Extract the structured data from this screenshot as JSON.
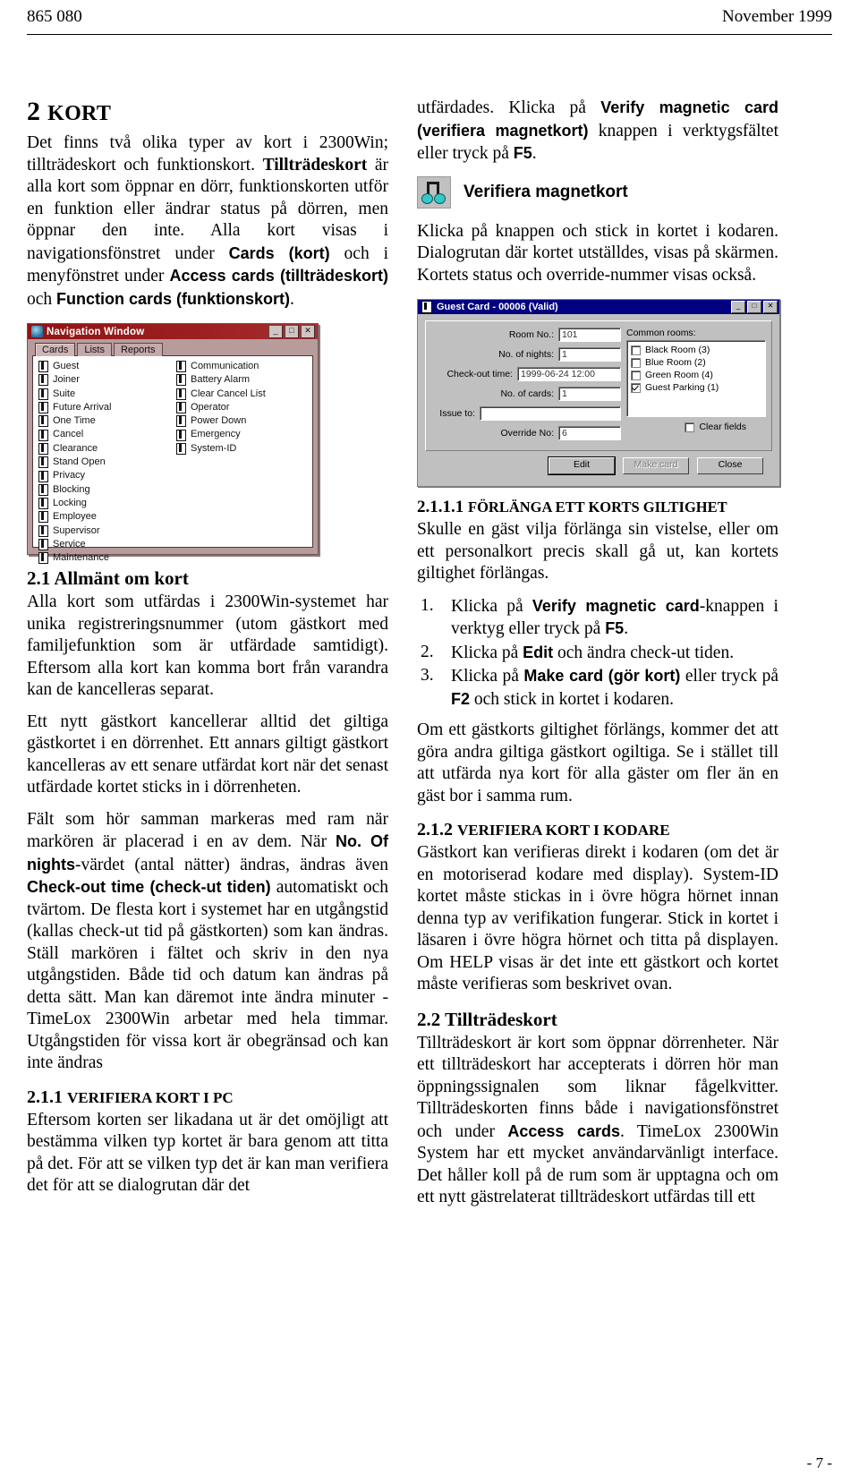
{
  "header": {
    "left": "865 080",
    "right": "November 1999"
  },
  "footer": {
    "page": "- 7 -"
  },
  "left_column": {
    "chapter_num": "2 ",
    "chapter_title": "KORT",
    "intro_p1_a": "Det finns två olika typer av kort i 2300Win; tillträdeskort och funktionskort. ",
    "intro_p1_b": "Tillträdeskort",
    "intro_p1_c": " är alla kort som öppnar en dörr, funktionskorten utför en funktion eller ändrar status på dörren, men öppnar den inte. Alla kort visas i navigationsfönstret under ",
    "intro_p1_d": "Cards (kort)",
    "intro_p1_e": " och i menyfönstret under ",
    "intro_p1_f": "Access cards (tillträdeskort)",
    "intro_p1_g": " och ",
    "intro_p1_h": "Function cards (funktionskort)",
    "intro_p1_i": ".",
    "sec21_title": "2.1 Allmänt om kort",
    "sec21_p1": "Alla kort som utfärdas i 2300Win-systemet har unika registreringsnummer (utom gästkort med familjefunktion som är utfärdade samtidigt). Eftersom alla kort kan komma bort från varandra kan de kancelleras separat.",
    "sec21_p2": "Ett nytt gästkort kancellerar alltid det giltiga gästkortet i en dörrenhet. Ett annars giltigt gästkort kancelleras av ett senare utfärdat kort när det senast utfärdade kortet sticks in i dörrenheten.",
    "sec21_p3_a": "Fält som hör samman markeras med ram när markören är placerad i en av dem. När ",
    "sec21_p3_b": "No. Of nights",
    "sec21_p3_c": "-värdet (antal nätter) ändras, ändras även ",
    "sec21_p3_d": "Check-out time (check-ut tiden)",
    "sec21_p3_e": " automatiskt och tvärtom. De flesta kort i systemet har en utgångstid (kallas check-ut tid på gästkorten) som kan ändras. Ställ markören i fältet och skriv in den nya utgångstiden. Både tid och datum kan ändras på detta sätt. Man kan däremot inte ändra minuter - TimeLox 2300Win arbetar med hela timmar. Utgångstiden för vissa kort är obegränsad och kan inte ändras",
    "sec211_num": "2.1.1 ",
    "sec211_title": "VERIFIERA KORT I PC",
    "sec211_p1": "Eftersom korten ser likadana ut är det omöjligt att bestämma vilken typ kortet är bara genom att titta på det. För att se vilken typ det är kan man verifiera det för att se dialogrutan där det"
  },
  "right_column": {
    "cont_p1_a": "utfärdades. Klicka på ",
    "cont_p1_b": "Verify magnetic card (verifiera magnetkort)",
    "cont_p1_c": " knappen i verktygsfältet eller tryck på ",
    "cont_p1_d": "F5",
    "cont_p1_e": ".",
    "toolbar_icon_label": "Verifiera magnetkort",
    "toolbar_icon_name": "verify-magnetic-card-icon",
    "cont_p2": "Klicka på knappen och stick in kortet i kodaren. Dialogrutan där kortet utställdes, visas på skärmen. Kortets status och override-nummer visas också.",
    "sec2111_num": "2.1.1.1 ",
    "sec2111_title": "FÖRLÄNGA ETT KORTS GILTIGHET",
    "sec2111_p1": "Skulle en gäst vilja förlänga sin vistelse, eller om ett personalkort precis skall gå ut, kan kortets giltighet förlängas.",
    "steps": [
      {
        "a": "Klicka på ",
        "b": "Verify magnetic card",
        "c": "-knappen i verktyg eller tryck på ",
        "d": "F5",
        "e": "."
      },
      {
        "a": "Klicka på ",
        "b": "Edit",
        "c": " och ändra check-ut tiden.",
        "d": "",
        "e": ""
      },
      {
        "a": "Klicka på ",
        "b": "Make card (gör kort)",
        "c": " eller tryck på ",
        "d": "F2",
        "e": " och stick in kortet i kodaren."
      }
    ],
    "sec2111_p2": "Om ett gästkorts giltighet förlängs, kommer det att göra andra giltiga gästkort ogiltiga. Se i stället till att utfärda nya kort för alla gäster om fler än en gäst bor i samma rum.",
    "sec212_num": "2.1.2 ",
    "sec212_title": "VERIFIERA KORT I KODARE",
    "sec212_p1": "Gästkort kan verifieras direkt i kodaren (om det är en motoriserad kodare med display). System-ID kortet måste stickas in i övre högra hörnet innan denna typ av verifikation fungerar. Stick in kortet i läsaren i övre högra hörnet och titta på displayen. Om HELP visas är det inte ett gästkort och kortet måste verifieras som beskrivet ovan.",
    "sec22_title": "2.2 Tillträdeskort",
    "sec22_p1_a": "Tillträdeskort är kort som öppnar dörrenheter. När ett tillträdeskort har accepterats i dörren hör man öppningssignalen som liknar fågelkvitter. Tillträdeskorten finns både i navigationsfönstret och under ",
    "sec22_p1_b": "Access cards",
    "sec22_p1_c": ". TimeLox 2300Win System har ett mycket användarvänligt interface. Det håller koll på de rum som är upptagna och om ett nytt gästrelaterat tillträdeskort utfärdas till ett"
  },
  "navigation_window": {
    "title": "Navigation Window",
    "window_buttons": [
      "_",
      "□",
      "✕"
    ],
    "tabs": [
      {
        "label": "Cards",
        "active": true
      },
      {
        "label": "Lists",
        "active": false
      },
      {
        "label": "Reports",
        "active": false
      }
    ],
    "column_left": [
      "Guest",
      "Joiner",
      "Suite",
      "Future Arrival",
      "One Time",
      "Cancel",
      "Clearance",
      "Stand Open",
      "Privacy",
      "Blocking",
      "Locking",
      "Employee",
      "Supervisor",
      "Service",
      "Maintenance"
    ],
    "column_right": [
      "Communication",
      "Battery Alarm",
      "Clear Cancel List",
      "Operator",
      "Power Down",
      "Emergency",
      "System-ID"
    ]
  },
  "guest_card": {
    "title": "Guest Card - 00006 (Valid)",
    "window_buttons": [
      "_",
      "□",
      "✕"
    ],
    "fields": [
      {
        "label": "Room No.:",
        "value": "101",
        "width": "w-short"
      },
      {
        "label": "No. of nights:",
        "value": "1",
        "width": "w-short"
      },
      {
        "label": "Check-out time:",
        "value": "1999-06-24 12:00",
        "width": "w-long"
      },
      {
        "label": "No. of cards:",
        "value": "1",
        "width": "w-short"
      },
      {
        "label": "Issue to:",
        "value": "",
        "width": "w-issue"
      },
      {
        "label": "Override No:",
        "value": "6",
        "width": "w-short"
      }
    ],
    "common_rooms_label": "Common rooms:",
    "common_rooms": [
      {
        "label": "Black Room (3)",
        "checked": false
      },
      {
        "label": "Blue Room (2)",
        "checked": false
      },
      {
        "label": "Green Room (4)",
        "checked": false
      },
      {
        "label": "Guest Parking (1)",
        "checked": true
      }
    ],
    "clear_fields_label": "Clear fields",
    "clear_fields_checked": false,
    "buttons": [
      {
        "label": "Edit",
        "state": "default"
      },
      {
        "label": "Make card",
        "state": "disabled"
      },
      {
        "label": "Close",
        "state": "normal"
      }
    ]
  }
}
